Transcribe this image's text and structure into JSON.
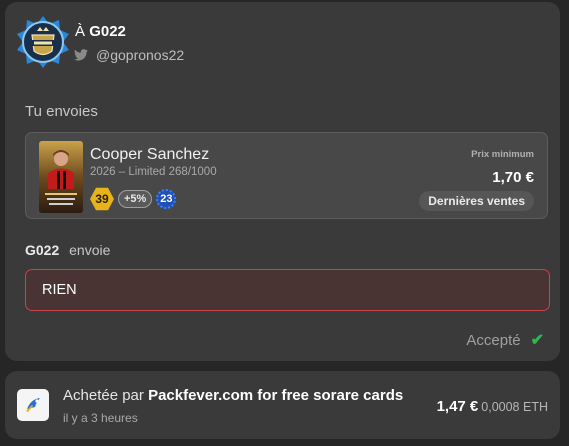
{
  "recipient": {
    "prefix": "À",
    "name": "G022",
    "handle": "@gopronos22"
  },
  "you_send": {
    "label": "Tu envoies",
    "card": {
      "player_name": "Cooper Sanchez",
      "details": "2026 – Limited 268/1000",
      "score": "39",
      "bonus": "+5%",
      "level": "23",
      "min_price_label": "Prix minimum",
      "min_price": "1,70 €",
      "last_sales_button": "Dernières ventes"
    }
  },
  "they_send": {
    "name": "G022",
    "verb": "envoie",
    "value": "RIEN"
  },
  "status": {
    "text": "Accepté",
    "color": "#2db84e"
  },
  "purchase": {
    "prefix": "Achetée par",
    "buyer": "Packfever.com for free sorare cards",
    "time_ago": "il y a 3 heures",
    "price_eur": "1,47 €",
    "price_eth": "0,0008 ETH"
  },
  "colors": {
    "accent_red": "#c8434a",
    "score_gold": "#e8b21a",
    "level_blue": "#1f4fb8"
  }
}
